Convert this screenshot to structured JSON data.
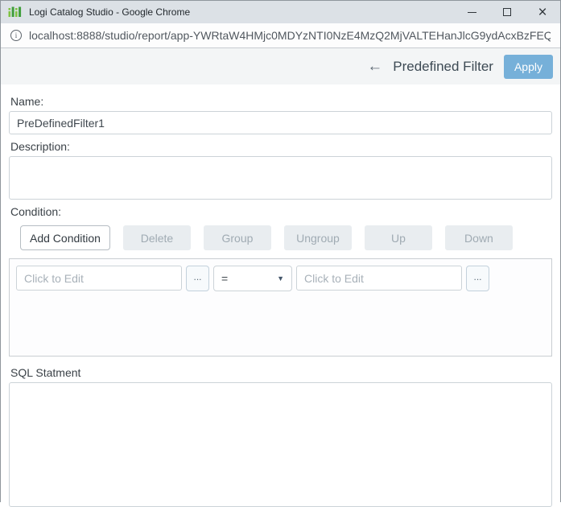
{
  "window": {
    "title": "Logi Catalog Studio - Google Chrome",
    "close_glyph": "×"
  },
  "address_bar": {
    "info_glyph": "i",
    "url": "localhost:8888/studio/report/app-YWRtaW4HMjc0MDYzNTI0NzE4MzQ2MjVALTEHanJlcG9ydAcxBzFEQ..."
  },
  "header": {
    "back_glyph": "←",
    "title": "Predefined Filter",
    "apply_label": "Apply",
    "accent_color": "#76b0d9"
  },
  "form": {
    "name_label": "Name:",
    "name_value": "PreDefinedFilter1",
    "description_label": "Description:",
    "description_value": "",
    "condition_label": "Condition:",
    "condition_buttons": [
      {
        "label": "Add Condition",
        "enabled": true
      },
      {
        "label": "Delete",
        "enabled": false
      },
      {
        "label": "Group",
        "enabled": false
      },
      {
        "label": "Ungroup",
        "enabled": false
      },
      {
        "label": "Up",
        "enabled": false
      },
      {
        "label": "Down",
        "enabled": false
      }
    ],
    "condition_row": {
      "left_placeholder": "Click to Edit",
      "left_picker_label": "...",
      "operator_value": "=",
      "operator_caret": "▼",
      "right_placeholder": "Click to Edit",
      "right_picker_label": "..."
    },
    "sql_label": "SQL Statment",
    "sql_value": ""
  },
  "icons": {
    "app_logo": "logi-green-bars",
    "minimize": "minimize-line",
    "maximize": "maximize-square",
    "close": "close-x",
    "page_info": "info-circle",
    "back": "left-arrow",
    "dropdown": "caret-down"
  }
}
